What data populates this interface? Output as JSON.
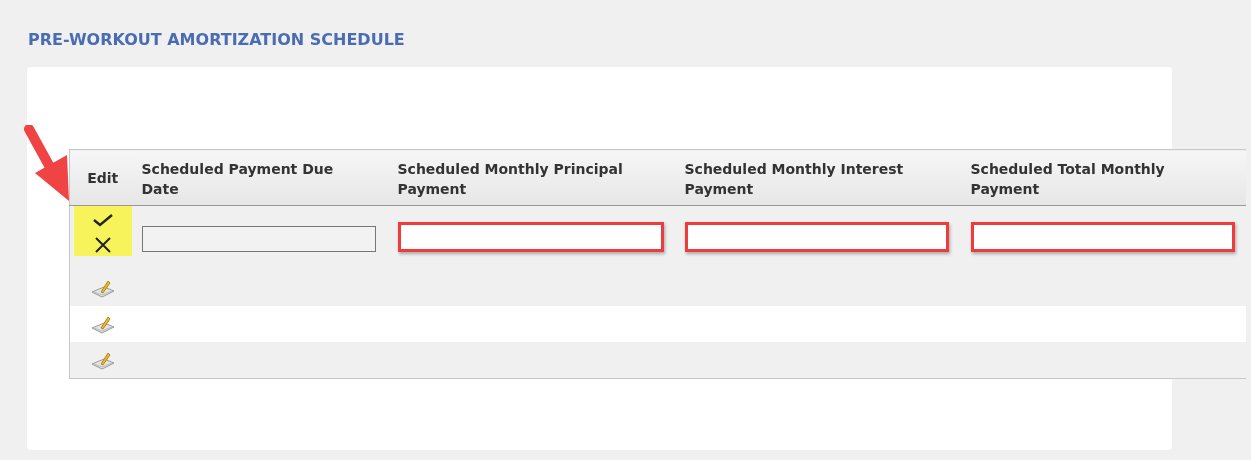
{
  "title": "PRE-WORKOUT AMORTIZATION SCHEDULE",
  "table": {
    "columns": [
      "Edit",
      "Scheduled Payment Due Date",
      "Scheduled Monthly Principal Payment",
      "Scheduled Monthly Interest Payment",
      "Scheduled Total Monthly Payment"
    ],
    "rows": [
      {
        "kind": "editing",
        "highlighted_action": true,
        "fields": [
          {
            "highlighted": false,
            "disabled": true
          },
          {
            "highlighted": true,
            "disabled": false
          },
          {
            "highlighted": true,
            "disabled": false
          },
          {
            "highlighted": true,
            "disabled": false
          }
        ]
      },
      {
        "kind": "view"
      },
      {
        "kind": "view"
      },
      {
        "kind": "view"
      }
    ]
  },
  "annotation": {
    "arrow": true
  }
}
